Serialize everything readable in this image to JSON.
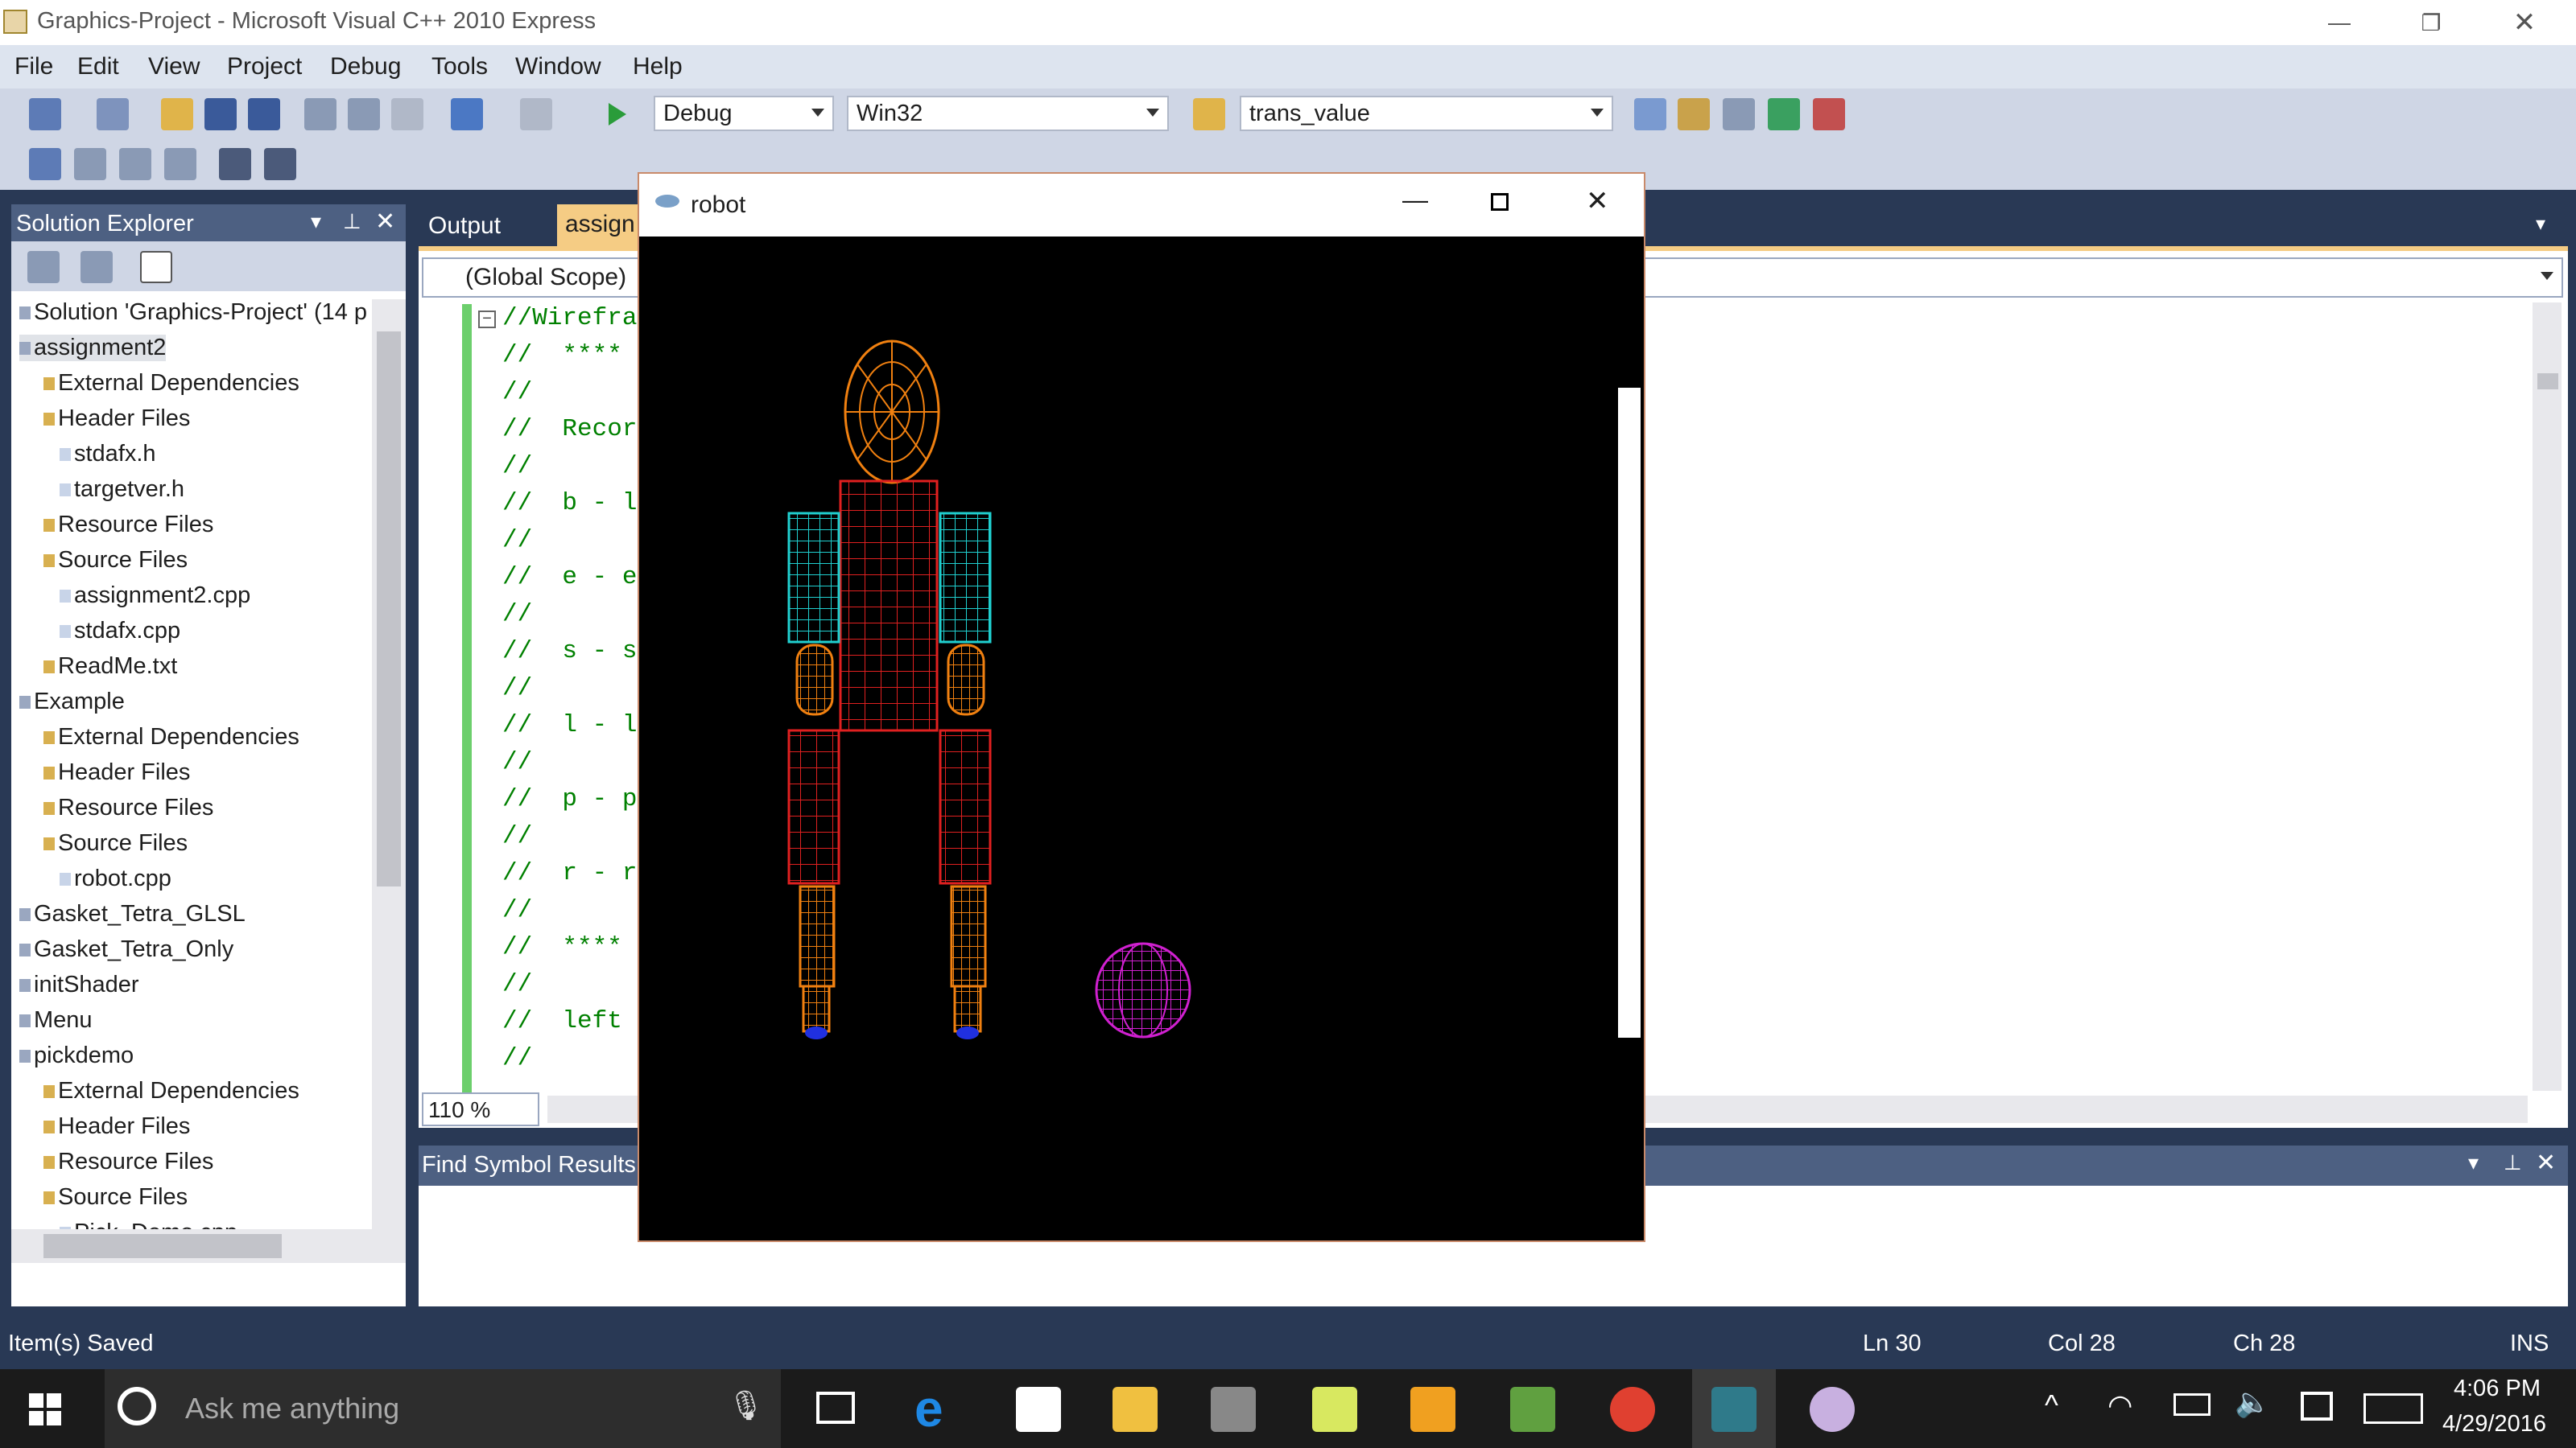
{
  "window": {
    "title": "Graphics-Project - Microsoft Visual C++ 2010 Express"
  },
  "menu": [
    "File",
    "Edit",
    "View",
    "Project",
    "Debug",
    "Tools",
    "Window",
    "Help"
  ],
  "toolbar": {
    "config": "Debug",
    "platform": "Win32",
    "find_value": "trans_value"
  },
  "solution_explorer": {
    "title": "Solution Explorer",
    "items": [
      {
        "label": "Solution 'Graphics-Project' (14 p",
        "indent": 0
      },
      {
        "label": "assignment2",
        "indent": 0
      },
      {
        "label": "External Dependencies",
        "indent": 1
      },
      {
        "label": "Header Files",
        "indent": 1
      },
      {
        "label": "stdafx.h",
        "indent": 2
      },
      {
        "label": "targetver.h",
        "indent": 2
      },
      {
        "label": "Resource Files",
        "indent": 1
      },
      {
        "label": "Source Files",
        "indent": 1
      },
      {
        "label": "assignment2.cpp",
        "indent": 2
      },
      {
        "label": "stdafx.cpp",
        "indent": 2
      },
      {
        "label": "ReadMe.txt",
        "indent": 1
      },
      {
        "label": "Example",
        "indent": 0
      },
      {
        "label": "External Dependencies",
        "indent": 1
      },
      {
        "label": "Header Files",
        "indent": 1
      },
      {
        "label": "Resource Files",
        "indent": 1
      },
      {
        "label": "Source Files",
        "indent": 1
      },
      {
        "label": "robot.cpp",
        "indent": 2
      },
      {
        "label": "Gasket_Tetra_GLSL",
        "indent": 0
      },
      {
        "label": "Gasket_Tetra_Only",
        "indent": 0
      },
      {
        "label": "initShader",
        "indent": 0
      },
      {
        "label": "Menu",
        "indent": 0
      },
      {
        "label": "pickdemo",
        "indent": 0
      },
      {
        "label": "External Dependencies",
        "indent": 1
      },
      {
        "label": "Header Files",
        "indent": 1
      },
      {
        "label": "Resource Files",
        "indent": 1
      },
      {
        "label": "Source Files",
        "indent": 1
      },
      {
        "label": "Pick_Demo.cpp",
        "indent": 2
      }
    ]
  },
  "editor": {
    "tabs": [
      "Output",
      "assign"
    ],
    "scope": "(Global Scope)",
    "zoom": "110 %",
    "lines": [
      "//Wirefra",
      "//  ****",
      "//",
      "//  Recor",
      "//",
      "//  b - l",
      "//",
      "//  e - e",
      "//",
      "//  s - s",
      "//",
      "//  l - l",
      "//",
      "//  p - p",
      "//",
      "//  r - r",
      "//",
      "//  ****",
      "//",
      "//  left",
      "//"
    ]
  },
  "find_panel": {
    "title": "Find Symbol Results"
  },
  "robot_window": {
    "title": "robot"
  },
  "status": {
    "message": "Item(s) Saved",
    "ln": "Ln 30",
    "col": "Col 28",
    "ch": "Ch 28",
    "mode": "INS"
  },
  "taskbar": {
    "search_placeholder": "Ask me anything",
    "time": "4:06 PM",
    "date": "4/29/2016"
  }
}
